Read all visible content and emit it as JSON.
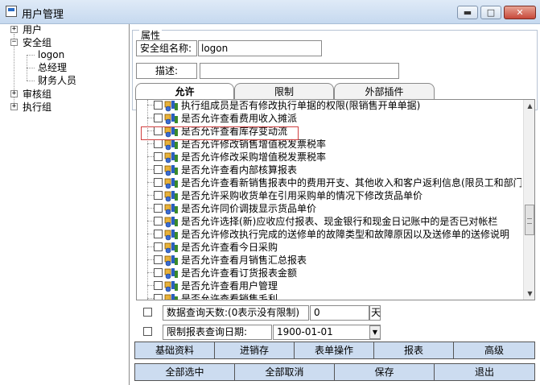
{
  "window": {
    "title": "用户管理",
    "min": "▬",
    "max": "□",
    "close": "✕"
  },
  "tree": {
    "nodes": [
      {
        "label": "用户",
        "expander": "+"
      },
      {
        "label": "安全组",
        "expander": "−"
      },
      {
        "label": "logon"
      },
      {
        "label": "总经理"
      },
      {
        "label": "财务人员"
      },
      {
        "label": "审核组",
        "expander": "+"
      },
      {
        "label": "执行组",
        "expander": "+"
      }
    ]
  },
  "properties": {
    "group_label": "属性",
    "name_label": "安全组名称:",
    "name_value": "logon",
    "desc_label": "描述:",
    "desc_value": ""
  },
  "tabs": [
    "允许",
    "限制",
    "外部插件"
  ],
  "permissions": [
    "执行组成员是否有修改执行单据的权限(限销售开单单据)",
    "是否允许查看费用收入摊派",
    "是否允许查看库存变动流",
    "是否允许修改销售增值税发票税率",
    "是否允许修改采购增值税发票税率",
    "是否允许查看内部核算报表",
    "是否允许查看新销售报表中的费用开支、其他收入和客户返利信息(限员工和部门",
    "是否允许采购收货单在引用采购单的情况下修改货品单价",
    "是否允许同价调拨显示货品单价",
    "是否允许选择(新)应收应付报表、现金银行和现金日记账中的是否已对帐栏",
    "是否允许修改执行完成的送修单的故障类型和故障原因以及送修单的送修说明",
    "是否允许查看今日采购",
    "是否允许查看月销售汇总报表",
    "是否允许查看订货报表金额",
    "是否允许查看用户管理",
    "是否允许查看销售毛利"
  ],
  "scroll": {
    "up": "▲",
    "down": "▼"
  },
  "options": {
    "days_label": "数据查询天数:(0表示没有限制)",
    "days_value": "0",
    "days_unit": "天",
    "date_label": "限制报表查询日期:",
    "date_value": "1900-01-01",
    "dropdown": "▼"
  },
  "category_buttons": [
    "基础资料",
    "进销存",
    "表单操作",
    "报表",
    "高级"
  ],
  "action_buttons": [
    "全部选中",
    "全部取消",
    "保存",
    "退出"
  ]
}
